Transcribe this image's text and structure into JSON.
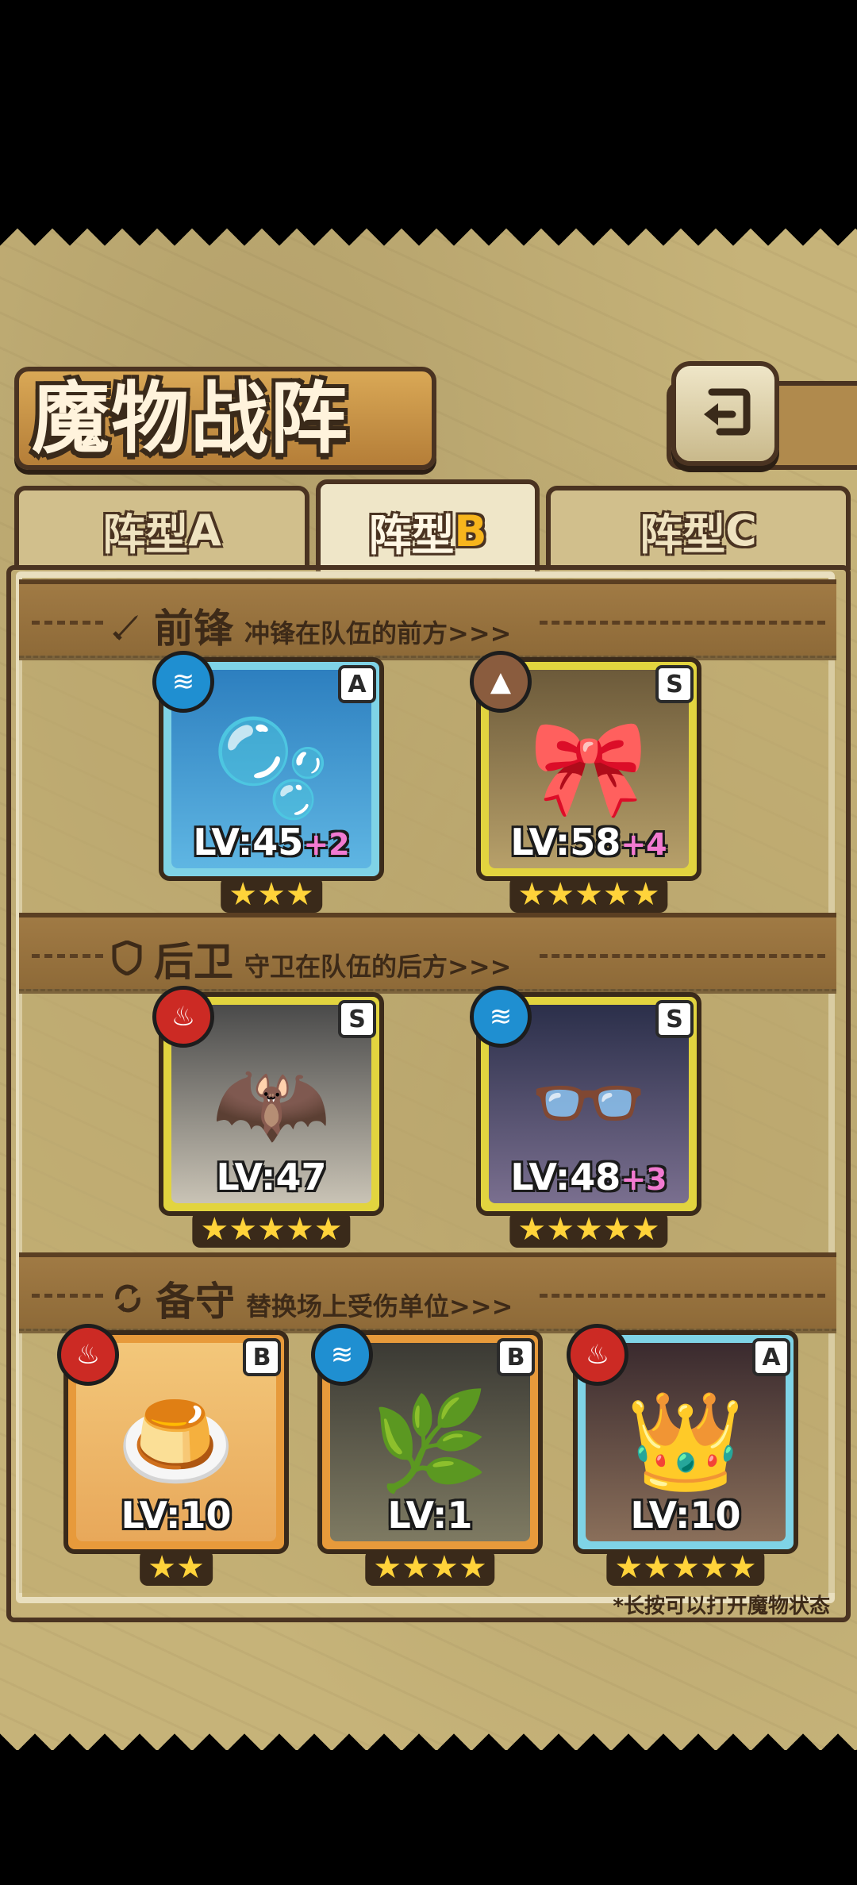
{
  "title": "魔物战阵",
  "tabs": [
    {
      "label": "阵型",
      "letter": "A",
      "active": false
    },
    {
      "label": "阵型",
      "letter": "B",
      "active": true
    },
    {
      "label": "阵型",
      "letter": "C",
      "active": false
    }
  ],
  "sections": [
    {
      "name": "前锋",
      "desc": "冲锋在队伍的前方>>>",
      "icon": "sword-icon"
    },
    {
      "name": "后卫",
      "desc": "守卫在队伍的后方>>>",
      "icon": "shield-icon"
    },
    {
      "name": "备守",
      "desc": "替换场上受伤单位>>>",
      "icon": "swap-icon"
    }
  ],
  "front_units": [
    {
      "level": "LV:45",
      "bonus": "+2",
      "rank": "A",
      "element": "water",
      "stars": "★★★"
    },
    {
      "level": "LV:58",
      "bonus": "+4",
      "rank": "S",
      "element": "earth",
      "stars": "★★★★★"
    }
  ],
  "back_units": [
    {
      "level": "LV:47",
      "bonus": "",
      "rank": "S",
      "element": "fire",
      "stars": "★★★★★"
    },
    {
      "level": "LV:48",
      "bonus": "+3",
      "rank": "S",
      "element": "water",
      "stars": "★★★★★"
    }
  ],
  "reserve_units": [
    {
      "level": "LV:10",
      "bonus": "",
      "rank": "B",
      "element": "fire",
      "stars": "★★"
    },
    {
      "level": "LV:1",
      "bonus": "",
      "rank": "B",
      "element": "water",
      "stars": "★★★★"
    },
    {
      "level": "LV:10",
      "bonus": "",
      "rank": "A",
      "element": "fire",
      "stars": "★★★★★"
    }
  ],
  "hint": "*长按可以打开魔物状态",
  "icons": {
    "back": "back-arrow-icon",
    "water": "water-element-icon",
    "fire": "fire-element-icon",
    "earth": "earth-element-icon"
  }
}
